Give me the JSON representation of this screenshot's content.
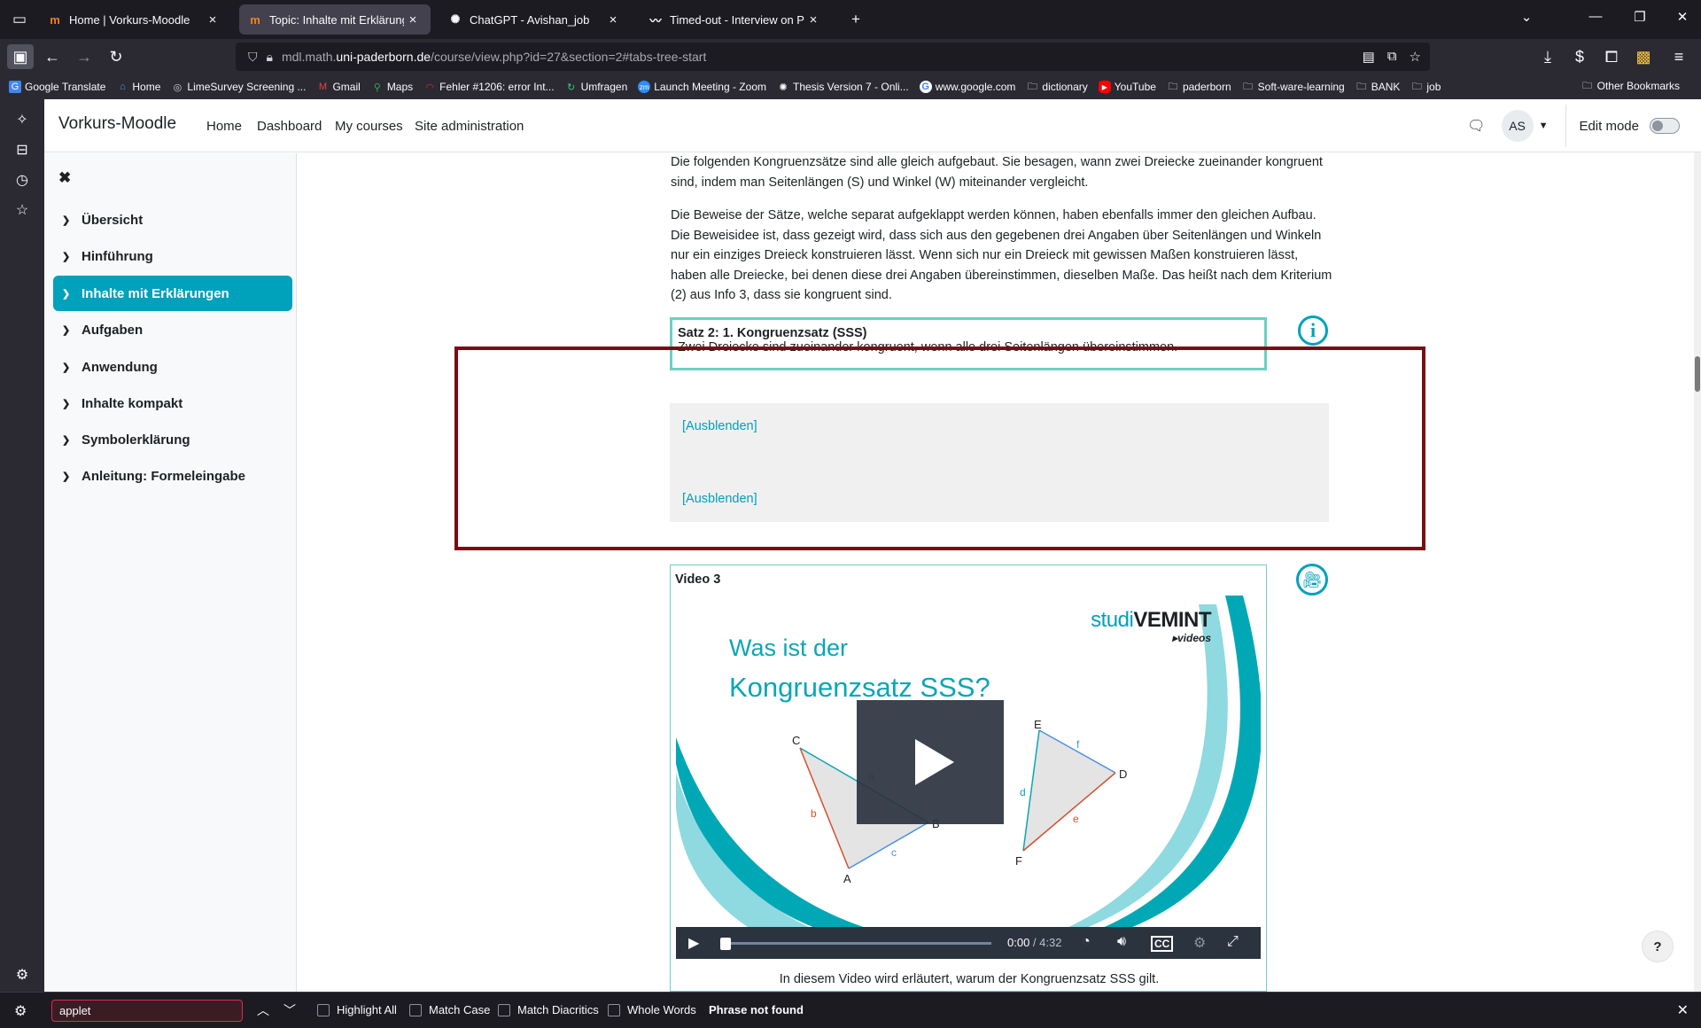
{
  "browser": {
    "tabs": [
      {
        "label": "Home | Vorkurs-Moodle",
        "icon": "moodle-icon",
        "active": false
      },
      {
        "label": "Topic: Inhalte mit Erklärungen | Vorkurs-Moodle",
        "icon": "moodle-icon",
        "active": true
      },
      {
        "label": "ChatGPT - Avishan_job",
        "icon": "chatgpt-icon",
        "active": false
      },
      {
        "label": "Timed-out - Interview on Password",
        "icon": "timed-out-icon",
        "active": false
      }
    ],
    "url_host": "mdl.math.",
    "url_domain": "uni-paderborn.de",
    "url_path": "/course/view.php?id=27&section=2#tabs-tree-start",
    "bookmarks": [
      {
        "label": "Google Translate",
        "icon": "google-translate-icon",
        "color": "#4285f4"
      },
      {
        "label": "Home",
        "icon": "home-icon",
        "color": "#5b8def"
      },
      {
        "label": "LimeSurvey Screening ...",
        "icon": "limesurvey-icon",
        "color": "#cccccc"
      },
      {
        "label": "Gmail",
        "icon": "gmail-icon",
        "color": "#ea4335"
      },
      {
        "label": "Maps",
        "icon": "maps-icon",
        "color": "#34a853"
      },
      {
        "label": "Fehler #1206: error Int...",
        "icon": "error-icon",
        "color": "#d32f2f"
      },
      {
        "label": "Umfragen",
        "icon": "umfragen-icon",
        "color": "#2ecc71"
      },
      {
        "label": "Launch Meeting - Zoom",
        "icon": "zoom-icon",
        "color": "#2d8cff"
      },
      {
        "label": "Thesis Version 7 - Onli...",
        "icon": "thesis-icon",
        "color": "#ffffff"
      },
      {
        "label": "www.google.com",
        "icon": "google-icon",
        "color": "#ffffff"
      },
      {
        "label": "dictionary",
        "icon": "folder-icon",
        "color": "#fbfbfe"
      },
      {
        "label": "YouTube",
        "icon": "youtube-icon",
        "color": "#ff0000"
      },
      {
        "label": "paderborn",
        "icon": "folder-icon",
        "color": "#fbfbfe"
      },
      {
        "label": "Soft-ware-learning",
        "icon": "folder-icon",
        "color": "#fbfbfe"
      },
      {
        "label": "BANK",
        "icon": "folder-icon",
        "color": "#fbfbfe"
      },
      {
        "label": "job",
        "icon": "folder-icon",
        "color": "#fbfbfe"
      }
    ],
    "other_bookmarks": "Other Bookmarks"
  },
  "moodle": {
    "brand": "Vorkurs-Moodle",
    "nav": [
      "Home",
      "Dashboard",
      "My courses",
      "Site administration"
    ],
    "avatar_initials": "AS",
    "edit_mode_label": "Edit mode",
    "edit_mode_on": false
  },
  "course_index": [
    {
      "label": "Übersicht",
      "active": false
    },
    {
      "label": "Hinführung",
      "active": false
    },
    {
      "label": "Inhalte mit Erklärungen",
      "active": true
    },
    {
      "label": "Aufgaben",
      "active": false
    },
    {
      "label": "Anwendung",
      "active": false
    },
    {
      "label": "Inhalte kompakt",
      "active": false
    },
    {
      "label": "Symbolerklärung",
      "active": false
    },
    {
      "label": "Anleitung: Formeleingabe",
      "active": false
    }
  ],
  "content": {
    "para1": "Die folgenden Kongruenzsätze sind alle gleich aufgebaut. Sie besagen, wann zwei Dreiecke zueinander kongruent sind, indem man Seitenlängen (S) und Winkel (W) miteinander vergleicht.",
    "para2": "Die Beweise der Sätze, welche separat aufgeklappt werden können, haben ebenfalls immer den gleichen Aufbau. Die Beweisidee ist, dass gezeigt wird, dass sich aus den gegebenen drei Angaben über Seitenlängen und Winkeln nur ein einziges Dreieck konstruieren lässt. Wenn sich nur ein Dreieck mit gewissen Maßen konstruieren lässt, haben alle Dreiecke, bei denen diese drei Angaben übereinstimmen, dieselben Maße. Das heißt nach dem Kriterium (2) aus Info 3, dass sie kongruent sind.",
    "satz_title": "Satz 2: 1. Kongruenzsatz (SSS)",
    "satz_text": "Zwei Dreiecke sind zueinander kongruent, wenn alle drei Seitenlängen übereinstimmen.",
    "hide_label_1": "[Ausblenden]",
    "hide_label_2": "[Ausblenden]",
    "video_title": "Video 3",
    "video_heading_1": "Was ist der",
    "video_heading_2": "Kongruenzsatz SSS?",
    "video_brand_light": "studi",
    "video_brand_bold": "VEMINT",
    "video_brand_sub": "▸videos",
    "triangle_labels": {
      "C": "C",
      "A": "A",
      "B": "B",
      "a": "a",
      "b": "b",
      "c": "c",
      "E": "E",
      "D": "D",
      "F": "F",
      "d": "d",
      "e": "e",
      "f": "f"
    },
    "time_current": "0:00",
    "time_sep": " / ",
    "time_total": "4:32",
    "video_caption": "In diesem Video wird erläutert, warum der Kongruenzsatz SSS gilt."
  },
  "findbar": {
    "query": "applet",
    "options": [
      "Highlight All",
      "Match Case",
      "Match Diacritics",
      "Whole Words"
    ],
    "status": "Phrase not found"
  },
  "colors": {
    "accent": "#00a1ba",
    "satz_border": "#6cd0c2",
    "highlight": "#7b0a14"
  }
}
